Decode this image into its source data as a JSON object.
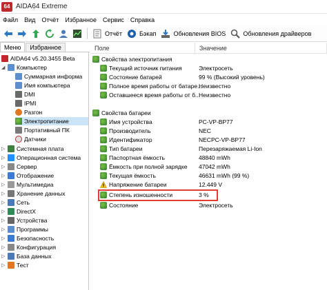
{
  "window": {
    "logo_text": "64",
    "title": "AIDA64 Extreme"
  },
  "menu": [
    "Файл",
    "Вид",
    "Отчёт",
    "Избранное",
    "Сервис",
    "Справка"
  ],
  "toolbar": {
    "report_label": "Отчёт",
    "backup_label": "Бэкап",
    "bios_update_label": "Обновления BIOS",
    "driver_update_label": "Обновления драйверов"
  },
  "tabs": {
    "menu": "Меню",
    "favorites": "Избранное"
  },
  "tree": {
    "root": "AIDA64 v5.20.3455 Beta",
    "computer": "Компьютер",
    "computer_children": [
      "Суммарная информа",
      "Имя компьютера",
      "DMI",
      "IPMI",
      "Разгон",
      "Электропитание",
      "Портативный ПК",
      "Датчики"
    ],
    "others": [
      "Системная плата",
      "Операционная система",
      "Сервер",
      "Отображение",
      "Мультимедиа",
      "Хранение данных",
      "Сеть",
      "DirectX",
      "Устройства",
      "Программы",
      "Безопасность",
      "Конфигурация",
      "База данных",
      "Тест"
    ]
  },
  "columns": {
    "field": "Поле",
    "value": "Значение"
  },
  "power": {
    "group": "Свойства электропитания",
    "rows": [
      {
        "field": "Текущий источник питания",
        "value": "Электросеть"
      },
      {
        "field": "Состояние батарей",
        "value": "99 % (Высокий уровень)"
      },
      {
        "field": "Полное время работы от батаре...",
        "value": "Неизвестно"
      },
      {
        "field": "Оставшееся время работы от б...",
        "value": "Неизвестно"
      }
    ]
  },
  "battery": {
    "group": "Свойства батареи",
    "rows": [
      {
        "field": "Имя устройства",
        "value": "PC-VP-BP77"
      },
      {
        "field": "Производитель",
        "value": "NEC"
      },
      {
        "field": "Идентификатор",
        "value": "NECPC-VP-BP77"
      },
      {
        "field": "Тип батареи",
        "value": "Перезаряжаемая Li-Ion"
      },
      {
        "field": "Паспортная ёмкость",
        "value": "48840 mWh"
      },
      {
        "field": "Ёмкость при полной зарядке",
        "value": "47042 mWh"
      },
      {
        "field": "Текущая ёмкость",
        "value": "46631 mWh  (99 %)"
      },
      {
        "field": "Напряжение батареи",
        "value": "12.449 V"
      },
      {
        "field": "Степень изношенности",
        "value": "3 %"
      },
      {
        "field": "Состояние",
        "value": "Электросеть"
      }
    ]
  },
  "colors": {
    "highlight": "#e03c31",
    "selected": "#cce4f7",
    "logo": "#c1272d"
  }
}
